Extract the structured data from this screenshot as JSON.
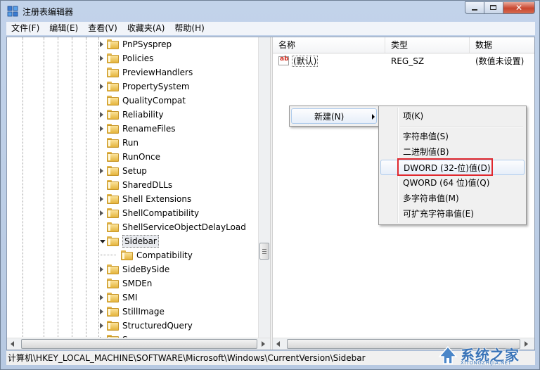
{
  "window": {
    "title": "注册表编辑器",
    "close_glyph": "✕"
  },
  "menubar": {
    "items": [
      "文件(F)",
      "编辑(E)",
      "查看(V)",
      "收藏夹(A)",
      "帮助(H)"
    ]
  },
  "tree": {
    "items": [
      {
        "label": "PnPSysprep",
        "expandable": true
      },
      {
        "label": "Policies",
        "expandable": true
      },
      {
        "label": "PreviewHandlers",
        "expandable": false
      },
      {
        "label": "PropertySystem",
        "expandable": true
      },
      {
        "label": "QualityCompat",
        "expandable": false
      },
      {
        "label": "Reliability",
        "expandable": true
      },
      {
        "label": "RenameFiles",
        "expandable": true
      },
      {
        "label": "Run",
        "expandable": false
      },
      {
        "label": "RunOnce",
        "expandable": false
      },
      {
        "label": "Setup",
        "expandable": true
      },
      {
        "label": "SharedDLLs",
        "expandable": false
      },
      {
        "label": "Shell Extensions",
        "expandable": true
      },
      {
        "label": "ShellCompatibility",
        "expandable": true
      },
      {
        "label": "ShellServiceObjectDelayLoad",
        "expandable": false
      },
      {
        "label": "Sidebar",
        "expandable": true,
        "expanded": true,
        "selected": true
      },
      {
        "label": "Compatibility",
        "expandable": false,
        "child": true
      },
      {
        "label": "SideBySide",
        "expandable": true
      },
      {
        "label": "SMDEn",
        "expandable": false
      },
      {
        "label": "SMI",
        "expandable": true
      },
      {
        "label": "StillImage",
        "expandable": true
      },
      {
        "label": "StructuredQuery",
        "expandable": true
      },
      {
        "label": "Syncmgr",
        "expandable": true
      }
    ]
  },
  "list": {
    "columns": [
      "名称",
      "类型",
      "数据"
    ],
    "rows": [
      {
        "icon": "string-value-icon",
        "icon_text": "ab",
        "name": "(默认)",
        "type": "REG_SZ",
        "data": "(数值未设置)"
      }
    ]
  },
  "context_menu": {
    "new_label": "新建(N)",
    "submenu": {
      "key_item": "项(K)",
      "value_items": [
        "字符串值(S)",
        "二进制值(B)",
        "DWORD (32-位)值(D)",
        "QWORD (64 位)值(Q)",
        "多字符串值(M)",
        "可扩充字符串值(E)"
      ],
      "hovered_index": 2,
      "highlight_color": "#e0282e"
    }
  },
  "statusbar": {
    "path": "计算机\\HKEY_LOCAL_MACHINE\\SOFTWARE\\Microsoft\\Windows\\CurrentVersion\\Sidebar"
  },
  "watermark": {
    "text": "系统之家",
    "sub": "XITONGZHIJIA.NET"
  }
}
